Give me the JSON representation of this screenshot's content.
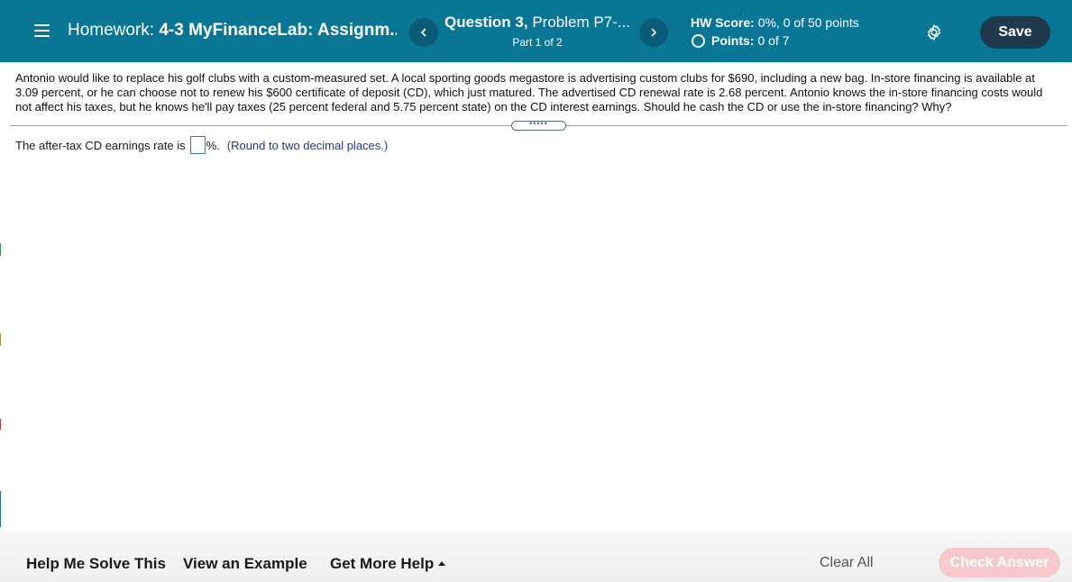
{
  "header": {
    "homework_label": "Homework:",
    "homework_name": "4-3 MyFinanceLab: Assignm...",
    "question_number": "Question 3,",
    "problem_label": "Problem P7-...",
    "part_text": "Part 1 of 2",
    "hw_score_label": "HW Score:",
    "hw_score_value": "0%, 0 of 50 points",
    "points_label": "Points:",
    "points_value": "0 of 7",
    "save_label": "Save",
    "icons": {
      "menu": "hamburger-menu-icon",
      "prev": "chevron-left-icon",
      "next": "chevron-right-icon",
      "points": "circle-outline-icon",
      "settings": "gear-icon"
    },
    "colors": {
      "bar": "#0a7696",
      "nav_button": "#0a5a78",
      "save_button": "#1f3a4d"
    }
  },
  "problem": {
    "text": "Antonio would like to replace his golf clubs with a custom-measured set. A local sporting goods megastore is advertising custom clubs for $690, including a new bag. In-store financing is available at 3.09 percent, or he can choose not to renew his $600 certificate of deposit (CD), which just matured. The advertised CD renewal rate is 2.68 percent. Antonio knows the in-store financing costs would not affect his taxes, but he knows he'll pay taxes (25 percent federal and 5.75 percent state) on the CD interest earnings. Should he cash the CD or use the in-store financing? Why?",
    "splitter_glyph": "•••••"
  },
  "answer": {
    "prompt": "The after-tax CD earnings rate is",
    "input_value": "",
    "suffix": "%.",
    "hint": "(Round to two decimal places.)"
  },
  "footer": {
    "help_me_solve": "Help Me Solve This",
    "view_example": "View an Example",
    "get_more_help": "Get More Help",
    "clear_all": "Clear All",
    "check_answer": "Check Answer",
    "colors": {
      "check_answer_disabled": "#f7c9cc"
    }
  }
}
